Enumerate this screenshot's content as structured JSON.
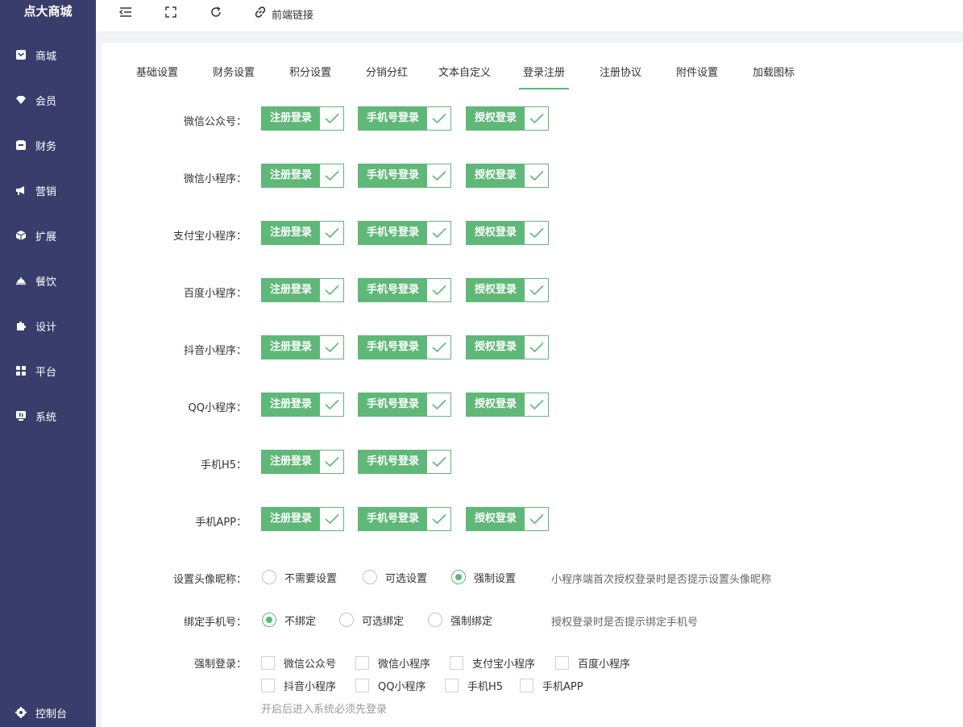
{
  "app": {
    "brand": "点大商城"
  },
  "sidebar": {
    "items": [
      {
        "label": "商城",
        "icon": "mail-icon"
      },
      {
        "label": "会员",
        "icon": "diamond-icon"
      },
      {
        "label": "财务",
        "icon": "wallet-icon"
      },
      {
        "label": "营销",
        "icon": "megaphone-icon"
      },
      {
        "label": "扩展",
        "icon": "cube-icon"
      },
      {
        "label": "餐饮",
        "icon": "cloche-icon"
      },
      {
        "label": "设计",
        "icon": "puzzle-icon"
      },
      {
        "label": "平台",
        "icon": "grid-icon"
      },
      {
        "label": "系统",
        "icon": "monitor-icon"
      }
    ],
    "bottom": {
      "label": "控制台",
      "icon": "gear-icon"
    }
  },
  "topbar": {
    "frontend_link": "前端链接"
  },
  "tabs": [
    {
      "label": "基础设置"
    },
    {
      "label": "财务设置"
    },
    {
      "label": "积分设置"
    },
    {
      "label": "分销分红"
    },
    {
      "label": "文本自定义"
    },
    {
      "label": "登录注册",
      "active": true
    },
    {
      "label": "注册协议"
    },
    {
      "label": "附件设置"
    },
    {
      "label": "加载图标"
    }
  ],
  "login_options": {
    "register": "注册登录",
    "phone": "手机号登录",
    "auth": "授权登录"
  },
  "platforms": [
    {
      "label": "微信公众号："
    },
    {
      "label": "微信小程序："
    },
    {
      "label": "支付宝小程序："
    },
    {
      "label": "百度小程序："
    },
    {
      "label": "抖音小程序："
    },
    {
      "label": "QQ小程序："
    },
    {
      "label": "手机H5："
    },
    {
      "label": "手机APP："
    }
  ],
  "avatar_setting": {
    "label": "设置头像昵称：",
    "options": [
      "不需要设置",
      "可选设置",
      "强制设置"
    ],
    "selected": 2,
    "hint": "小程序端首次授权登录时是否提示设置头像昵称"
  },
  "bind_phone": {
    "label": "绑定手机号：",
    "options": [
      "不绑定",
      "可选绑定",
      "强制绑定"
    ],
    "selected": 0,
    "hint": "授权登录时是否提示绑定手机号"
  },
  "force_login": {
    "label": "强制登录：",
    "options": [
      "微信公众号",
      "微信小程序",
      "支付宝小程序",
      "百度小程序",
      "抖音小程序",
      "QQ小程序",
      "手机H5",
      "手机APP"
    ],
    "hint": "开启后进入系统必须先登录"
  },
  "colors": {
    "sidebar": "#393D6B",
    "accent": "#5FB878"
  }
}
